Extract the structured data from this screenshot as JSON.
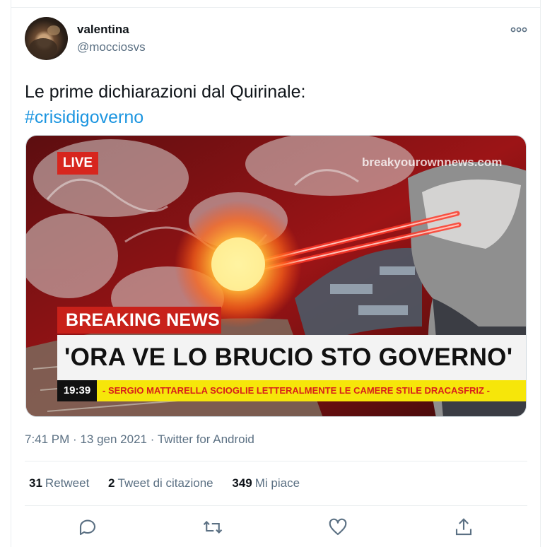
{
  "tweet": {
    "author": {
      "display_name": "valentina",
      "handle": "@mocciosvs"
    },
    "text": "Le prime dichiarazioni dal Quirinale:",
    "hashtag": "#crisidigoverno",
    "media": {
      "live_label": "LIVE",
      "watermark": "breakyourownnews.com",
      "breaking_label": "BREAKING NEWS",
      "headline": "'ORA VE LO BRUCIO STO GOVERNO'",
      "clock": "19:39",
      "ticker": "- SERGIO MATTARELLA SCIOGLIE LETTERALMENTE LE CAMERE STILE DRACASFRIZ -"
    },
    "meta": {
      "time": "7:41 PM",
      "date": "13 gen 2021",
      "separator": "·",
      "source": "Twitter for Android"
    },
    "stats": {
      "retweets": {
        "count": "31",
        "label": "Retweet"
      },
      "quotes": {
        "count": "2",
        "label": "Tweet di citazione"
      },
      "likes": {
        "count": "349",
        "label": "Mi piace"
      }
    },
    "actions": [
      "reply-icon",
      "retweet-icon",
      "like-icon",
      "share-icon"
    ],
    "colors": {
      "link": "#1b95e0",
      "secondary_text": "#5b7083",
      "icon": "#5b7083",
      "breaking_red": "#c8211a",
      "ticker_yellow": "#f6e60a"
    }
  }
}
